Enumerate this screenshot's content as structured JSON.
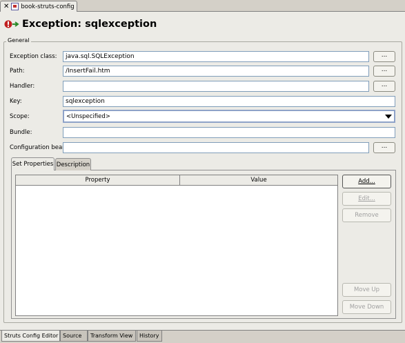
{
  "editor_tab": {
    "label": "book-struts-config"
  },
  "header": {
    "title": "Exception: sqlexception"
  },
  "general": {
    "legend": "General",
    "browse_label": "...",
    "fields": {
      "exception_class": {
        "label": "Exception class:",
        "value": "java.sql.SQLException"
      },
      "path": {
        "label": "Path:",
        "value": "/InsertFail.htm"
      },
      "handler": {
        "label": "Handler:",
        "value": ""
      },
      "key": {
        "label": "Key:",
        "value": "sqlexception"
      },
      "scope": {
        "label": "Scope:",
        "value": "<Unspecified>"
      },
      "bundle": {
        "label": "Bundle:",
        "value": ""
      },
      "config_bean": {
        "label": "Configuration bean:",
        "value": ""
      }
    }
  },
  "inner_tabs": {
    "set_properties": "Set Properties",
    "description": "Description"
  },
  "table": {
    "columns": [
      "Property",
      "Value"
    ]
  },
  "buttons": {
    "add": "Add...",
    "edit": "Edit...",
    "remove": "Remove",
    "move_up": "Move Up",
    "move_down": "Move Down"
  },
  "bottom_tabs": [
    "Struts Config Editor",
    "Source",
    "Transform View",
    "History"
  ]
}
